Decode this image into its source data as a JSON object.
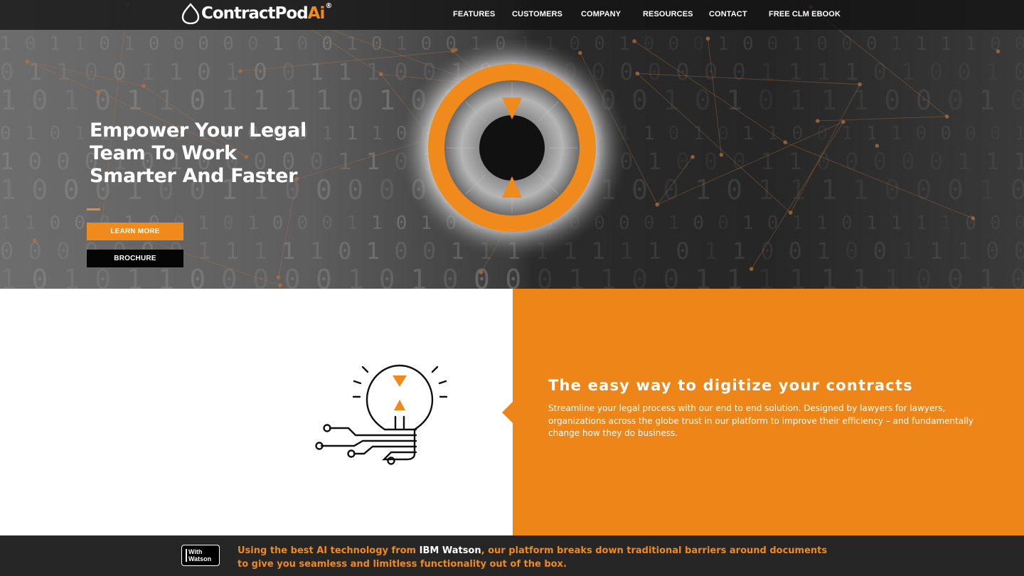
{
  "brand": {
    "logo_text": "ContractPod",
    "logo_accent": "Ai",
    "logo_mark": "®",
    "accent_color": "#f08a1c",
    "dark_color": "#262626"
  },
  "nav": {
    "items": [
      {
        "label": "FEATURES"
      },
      {
        "label": "CUSTOMERS"
      },
      {
        "label": "COMPANY"
      },
      {
        "label": "RESOURCES"
      },
      {
        "label": "CONTACT"
      },
      {
        "label": "FREE CLM EBOOK"
      }
    ]
  },
  "hero": {
    "headline": "Empower Your Legal Team To Work Smarter And Faster",
    "learn_more_label": "LEARN MORE",
    "brochure_label": "BROCHURE"
  },
  "feature": {
    "title": "The easy way to digitize your contracts",
    "description": "Streamline your legal process with our end to end solution. Designed by lawyers for lawyers, organizations across the globe trust in our platform to improve their efficiency – and fundamentally change how they do business."
  },
  "footer": {
    "badge_line1": "With",
    "badge_line2": "Watson",
    "text_before": "Using the best AI technology from ",
    "text_highlight": "IBM Watson",
    "text_after": ", our platform breaks down traditional barriers around documents to give you seamless and limitless functionality out of the box."
  },
  "icons": [
    "contractpodai-logo-icon",
    "eye-icon",
    "lightbulb-circuit-icon",
    "watson-badge-icon"
  ]
}
